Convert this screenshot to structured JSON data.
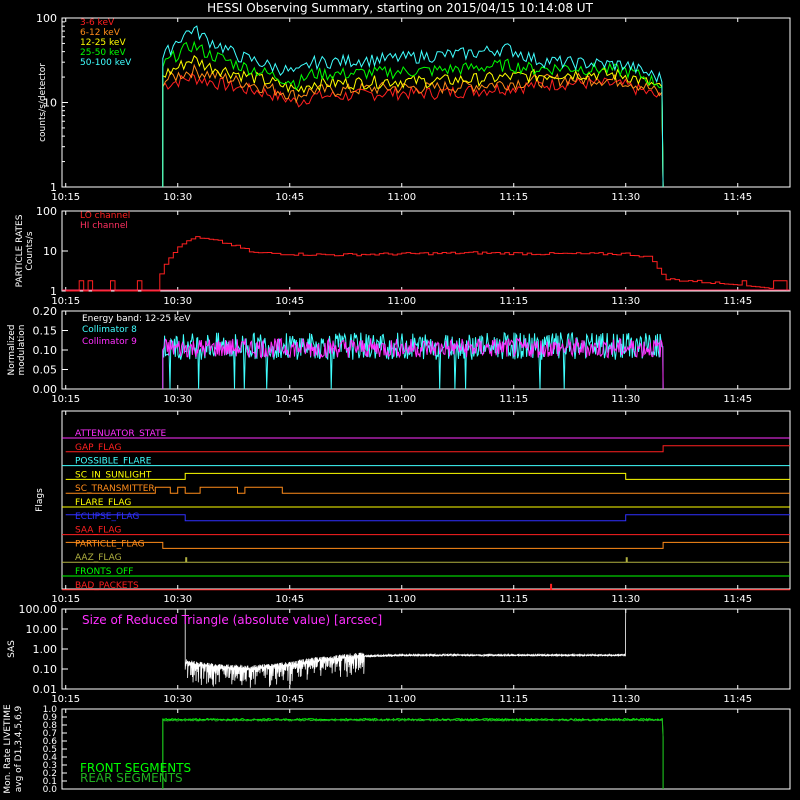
{
  "title": "HESSI Observing Summary, starting on 2015/04/15 10:14:08 UT",
  "time_ticks": [
    "10:15",
    "10:30",
    "10:45",
    "11:00",
    "11:15",
    "11:30",
    "11:45"
  ],
  "colors": {
    "background": "#000000",
    "axis": "#ffffff",
    "red": "#ff2020",
    "orange": "#ff8c1a",
    "yellow": "#ffff00",
    "green": "#00ff00",
    "cyan": "#40ffff",
    "magenta": "#ff30ff",
    "blue": "#3030ff",
    "olive": "#b0b040"
  },
  "chart_data": [
    {
      "type": "line",
      "panel": "count-rates",
      "ylabel": "counts/s/detector",
      "yscale": "log",
      "ylim": [
        1,
        100
      ],
      "yticks": [
        "1",
        "10",
        "100"
      ],
      "xlim": [
        "10:15",
        "11:52"
      ],
      "legend": [
        "3-6 keV",
        "6-12 keV",
        "12-25 keV",
        "25-50 keV",
        "50-100 keV"
      ],
      "x": [
        "10:28",
        "10:30",
        "10:32",
        "10:34",
        "10:38",
        "10:42",
        "10:46",
        "10:48",
        "10:52",
        "10:58",
        "11:04",
        "11:10",
        "11:14",
        "11:18",
        "11:22",
        "11:26",
        "11:30",
        "11:33",
        "11:35"
      ],
      "series": [
        {
          "name": "3-6 keV",
          "values": [
            16,
            18,
            20,
            18,
            15,
            13,
            10,
            12,
            12,
            13,
            13,
            14,
            15,
            16,
            17,
            17,
            16,
            13,
            11
          ]
        },
        {
          "name": "6-12 keV",
          "values": [
            18,
            21,
            24,
            22,
            18,
            15,
            12,
            14,
            14,
            15,
            15,
            16,
            17,
            18,
            19,
            19,
            18,
            15,
            12
          ]
        },
        {
          "name": "12-25 keV",
          "values": [
            21,
            26,
            33,
            27,
            22,
            18,
            14,
            17,
            17,
            18,
            18,
            19,
            20,
            21,
            22,
            22,
            21,
            17,
            14
          ]
        },
        {
          "name": "25-50 keV",
          "values": [
            27,
            38,
            48,
            38,
            28,
            22,
            17,
            22,
            22,
            23,
            24,
            26,
            28,
            25,
            26,
            25,
            24,
            19,
            16
          ]
        },
        {
          "name": "50-100 keV",
          "values": [
            33,
            55,
            75,
            55,
            36,
            28,
            22,
            30,
            31,
            33,
            36,
            39,
            44,
            32,
            30,
            29,
            28,
            22,
            19
          ]
        }
      ]
    },
    {
      "type": "line",
      "panel": "particle-rates",
      "ylabel": "PARTICLE RATES Counts/s",
      "yscale": "log",
      "ylim": [
        1,
        100
      ],
      "yticks": [
        "1",
        "10",
        "100"
      ],
      "legend": [
        "LO channel",
        "HI channel"
      ],
      "x": [
        "10:15",
        "10:27",
        "10:28",
        "10:30",
        "10:32",
        "10:35",
        "10:40",
        "10:50",
        "11:00",
        "11:10",
        "11:20",
        "11:30",
        "11:33",
        "11:35",
        "11:52"
      ],
      "series": [
        {
          "name": "LO channel",
          "values": [
            1,
            1,
            4,
            12,
            22,
            18,
            9,
            8,
            8.5,
            9,
            8.5,
            8.5,
            7,
            2,
            1
          ]
        },
        {
          "name": "HI channel",
          "values": [
            1,
            1,
            1,
            1,
            1,
            1,
            1,
            1,
            1,
            1,
            1,
            1,
            1,
            1,
            1
          ]
        }
      ]
    },
    {
      "type": "line",
      "panel": "modulation",
      "ylabel": "Normalized modulation",
      "ylim": [
        0,
        0.2
      ],
      "yticks": [
        "0.00",
        "0.05",
        "0.10",
        "0.15",
        "0.20"
      ],
      "annotation": "Energy band: 12-25 keV",
      "legend": [
        "Collimator 8",
        "Collimator 9"
      ],
      "x": [
        "10:28",
        "11:35"
      ],
      "series": [
        {
          "name": "Collimator 8",
          "values": [
            0.11,
            0.11
          ]
        },
        {
          "name": "Collimator 9",
          "values": [
            0.105,
            0.105
          ]
        }
      ]
    },
    {
      "type": "table",
      "panel": "flags",
      "ylabel": "Flags",
      "flags": [
        {
          "name": "ATTENUATOR_STATE",
          "color": "#ff30ff"
        },
        {
          "name": "GAP_FLAG",
          "color": "#ff2020"
        },
        {
          "name": "POSSIBLE_FLARE",
          "color": "#40ffff"
        },
        {
          "name": "SC_IN_SUNLIGHT",
          "color": "#ffff00"
        },
        {
          "name": "SC_TRANSMITTER",
          "color": "#ff8c1a"
        },
        {
          "name": "FLARE_FLAG",
          "color": "#ffff00"
        },
        {
          "name": "ECLIPSE_FLAG",
          "color": "#3030ff"
        },
        {
          "name": "SAA_FLAG",
          "color": "#ff2020"
        },
        {
          "name": "PARTICLE_FLAG",
          "color": "#ff8c1a"
        },
        {
          "name": "AAZ_FLAG",
          "color": "#b0b040"
        },
        {
          "name": "FRONTS_OFF",
          "color": "#00ff00"
        },
        {
          "name": "BAD_PACKETS",
          "color": "#ff2020"
        }
      ]
    },
    {
      "type": "line",
      "panel": "sas",
      "ylabel": "SAS",
      "yscale": "log",
      "ylim": [
        0.01,
        100
      ],
      "yticks": [
        "0.01",
        "0.10",
        "1.00",
        "10.00",
        "100.00"
      ],
      "annotation": "Size of Reduced Triangle (absolute value) [arcsec]",
      "x": [
        "10:31",
        "10:35",
        "10:40",
        "10:45",
        "10:50",
        "10:55",
        "11:00",
        "11:10",
        "11:20",
        "11:30"
      ],
      "series": [
        {
          "values": [
            0.2,
            0.12,
            0.1,
            0.15,
            0.3,
            0.45,
            0.5,
            0.5,
            0.5,
            0.5
          ]
        }
      ]
    },
    {
      "type": "line",
      "panel": "livetime",
      "ylabel": "Mon. Rate LIVETIME avg of D1,3,4,5,6,9",
      "ylim": [
        0,
        1.0
      ],
      "yticks": [
        "0.0",
        "0.1",
        "0.2",
        "0.3",
        "0.4",
        "0.5",
        "0.6",
        "0.7",
        "0.8",
        "0.9",
        "1.0"
      ],
      "legend": [
        "FRONT SEGMENTS",
        "REAR SEGMENTS"
      ],
      "x": [
        "10:28",
        "11:35"
      ],
      "series": [
        {
          "name": "FRONT SEGMENTS",
          "values": [
            0.87,
            0.87
          ]
        },
        {
          "name": "REAR SEGMENTS",
          "values": [
            0.86,
            0.86
          ]
        }
      ]
    }
  ]
}
